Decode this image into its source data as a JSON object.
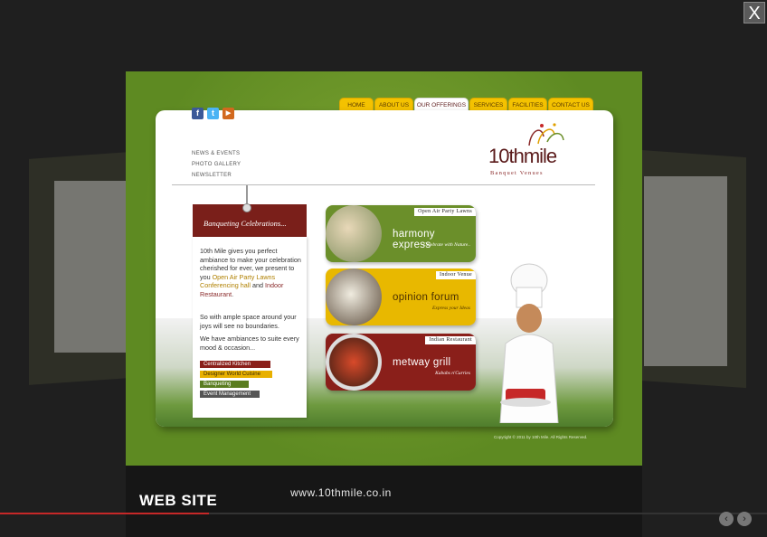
{
  "lightbox": {
    "close_label": "X",
    "caption": "WEB SITE",
    "url": "www.10thmile.co.in",
    "prev_label": "‹",
    "next_label": "›"
  },
  "site": {
    "nav": [
      "HOME",
      "ABOUT US",
      "OUR OFFERINGS",
      "SERVICES",
      "FACILITIES",
      "CONTACT US"
    ],
    "active_nav": "OUR OFFERINGS",
    "social": {
      "facebook": "f",
      "twitter": "t",
      "youtube": "▶"
    },
    "top_links": [
      "NEWS & EVENTS",
      "PHOTO GALLERY",
      "NEWSLETTER"
    ],
    "logo": {
      "main": "10thmile",
      "sub": "Banquet Venues"
    },
    "card": {
      "title": "Banqueting Celebrations...",
      "p1_a": "10th Mile gives you perfect ambiance to make your celebration cherished for ever, we present to you",
      "p1_hl1": "Open Air Party Lawns",
      "p1_hl2": "Conferencing hall",
      "p1_and": "and",
      "p1_hl3": "Indoor Restaurant",
      "p1_end": ".",
      "p2": "So with ample space around your joys will see no boundaries.",
      "p3": "We have ambiances to  suite every mood & occasion...",
      "chips": [
        "Centralized Kitchen",
        "Designer World Cuisine",
        "Banqueting",
        "Event Management"
      ]
    },
    "venues": [
      {
        "label": "Open Air Party Lawns",
        "name": "harmony express",
        "tag": "Celebrate with Nature..",
        "color": "#6b8f2a"
      },
      {
        "label": "Indoor Venue",
        "name": "opinion forum",
        "tag": "Express your Ideas",
        "color": "#e8b800"
      },
      {
        "label": "Indian Restaurant",
        "name": "metway grill",
        "tag": "Kababs n'Curries",
        "color": "#8a1f1a"
      }
    ],
    "copyright": "Copyright © 2011 by 10th Mile. All Rights Reserved."
  },
  "colors": {
    "accent": "#c62828",
    "slide_green": "#6e9327",
    "nav_yellow": "#f4c200",
    "maroon": "#7a1f1a"
  }
}
